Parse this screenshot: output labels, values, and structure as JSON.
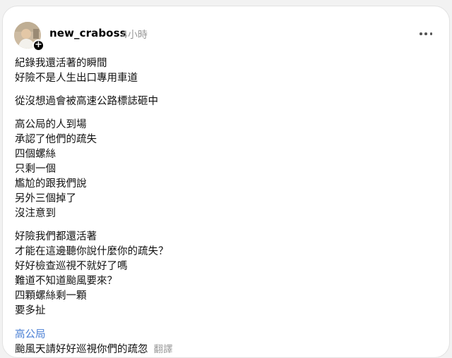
{
  "post": {
    "username": "new_craboss",
    "timestamp": "4小時",
    "paragraphs": [
      [
        "紀錄我還活著的瞬間",
        "好險不是人生出口專用車道"
      ],
      [
        "從沒想過會被高速公路標誌砸中"
      ],
      [
        "高公局的人到場",
        "承認了他們的疏失",
        "四個螺絲",
        "只剩一個",
        "尷尬的跟我們說",
        "另外三個掉了",
        "沒注意到"
      ],
      [
        "好險我們都還活著",
        "才能在這邊聽你說什麼你的疏失？",
        "好好檢查巡視不就好了嗎",
        "難道不知道颱風要來？",
        "四顆螺絲剩一顆",
        "要多扯"
      ]
    ],
    "tag": "高公局",
    "last_line": "颱風天請好好巡視你們的疏忽",
    "translate_label": "翻譯"
  },
  "icons": {
    "avatar": "avatar-photo",
    "follow": "plus-icon",
    "more": "more-options-icon"
  },
  "colors": {
    "link": "#4a7fd4",
    "muted": "#999999",
    "text": "#111111"
  }
}
